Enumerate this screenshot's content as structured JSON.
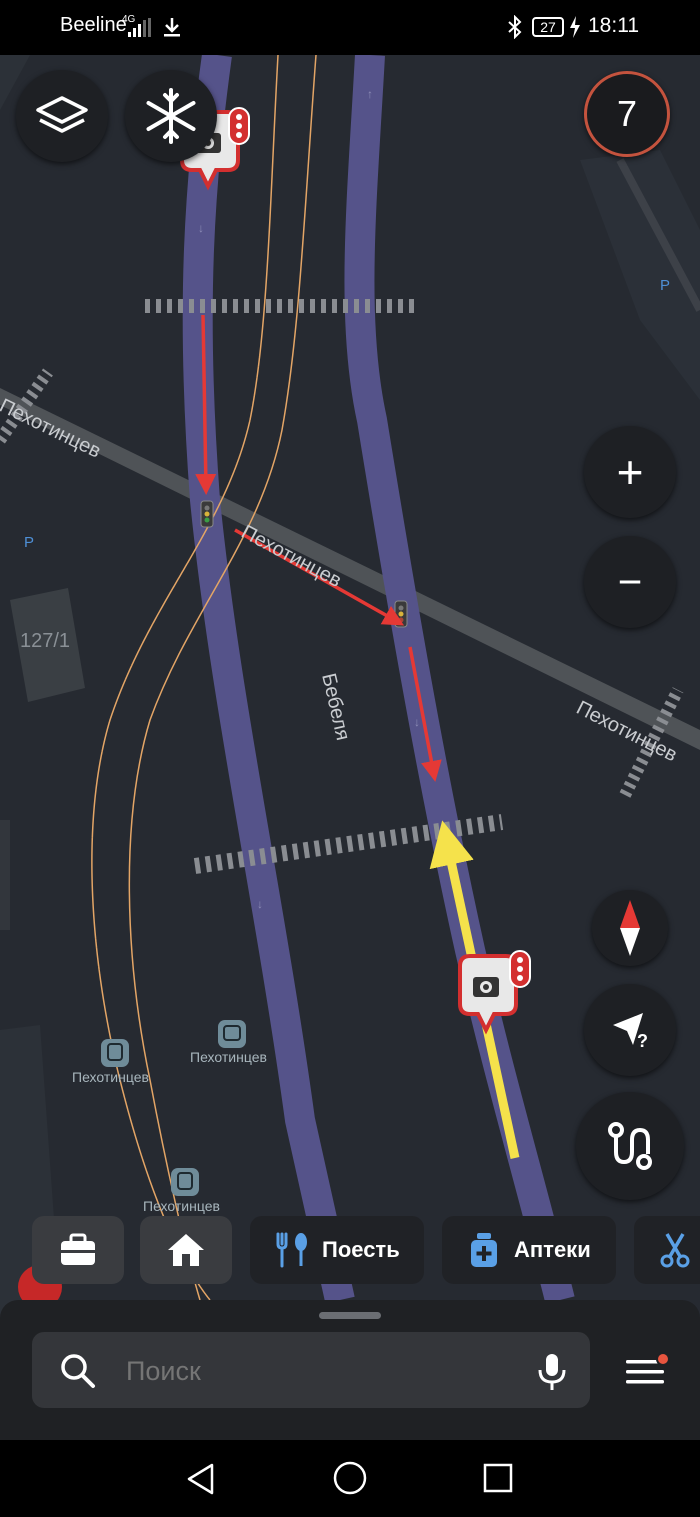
{
  "status_bar": {
    "carrier": "Beeline",
    "network": "4G",
    "battery": "27",
    "time": "18:11"
  },
  "map": {
    "street_labels": [
      "Пехотинцев",
      "Пехотинцев",
      "Пехотинцев",
      "Бебеля"
    ],
    "building_label": "127/1",
    "parking_labels": [
      "P",
      "P"
    ],
    "stops": [
      "Пехотинцев",
      "Пехотинцев",
      "Пехотинцев"
    ],
    "speed_limit": "7",
    "colors": {
      "road": "#5b5a8e",
      "arrow_red": "#e53935",
      "arrow_yellow": "#f5e24b",
      "rail": "#e3a566",
      "speed_ring": "#c4533e"
    }
  },
  "controls": {
    "layers_icon": "layers-icon",
    "weather_icon": "snowflake-icon",
    "zoom_in": "+",
    "zoom_out": "−",
    "compass_icon": "compass-icon",
    "locate_icon": "location-unknown-icon",
    "route_icon": "route-icon"
  },
  "categories": [
    {
      "icon": "briefcase-icon",
      "label": ""
    },
    {
      "icon": "home-icon",
      "label": ""
    },
    {
      "icon": "restaurant-icon",
      "label": "Поесть"
    },
    {
      "icon": "pharmacy-icon",
      "label": "Аптеки"
    },
    {
      "icon": "scissors-icon",
      "label": ""
    }
  ],
  "search": {
    "placeholder": "Поиск"
  }
}
